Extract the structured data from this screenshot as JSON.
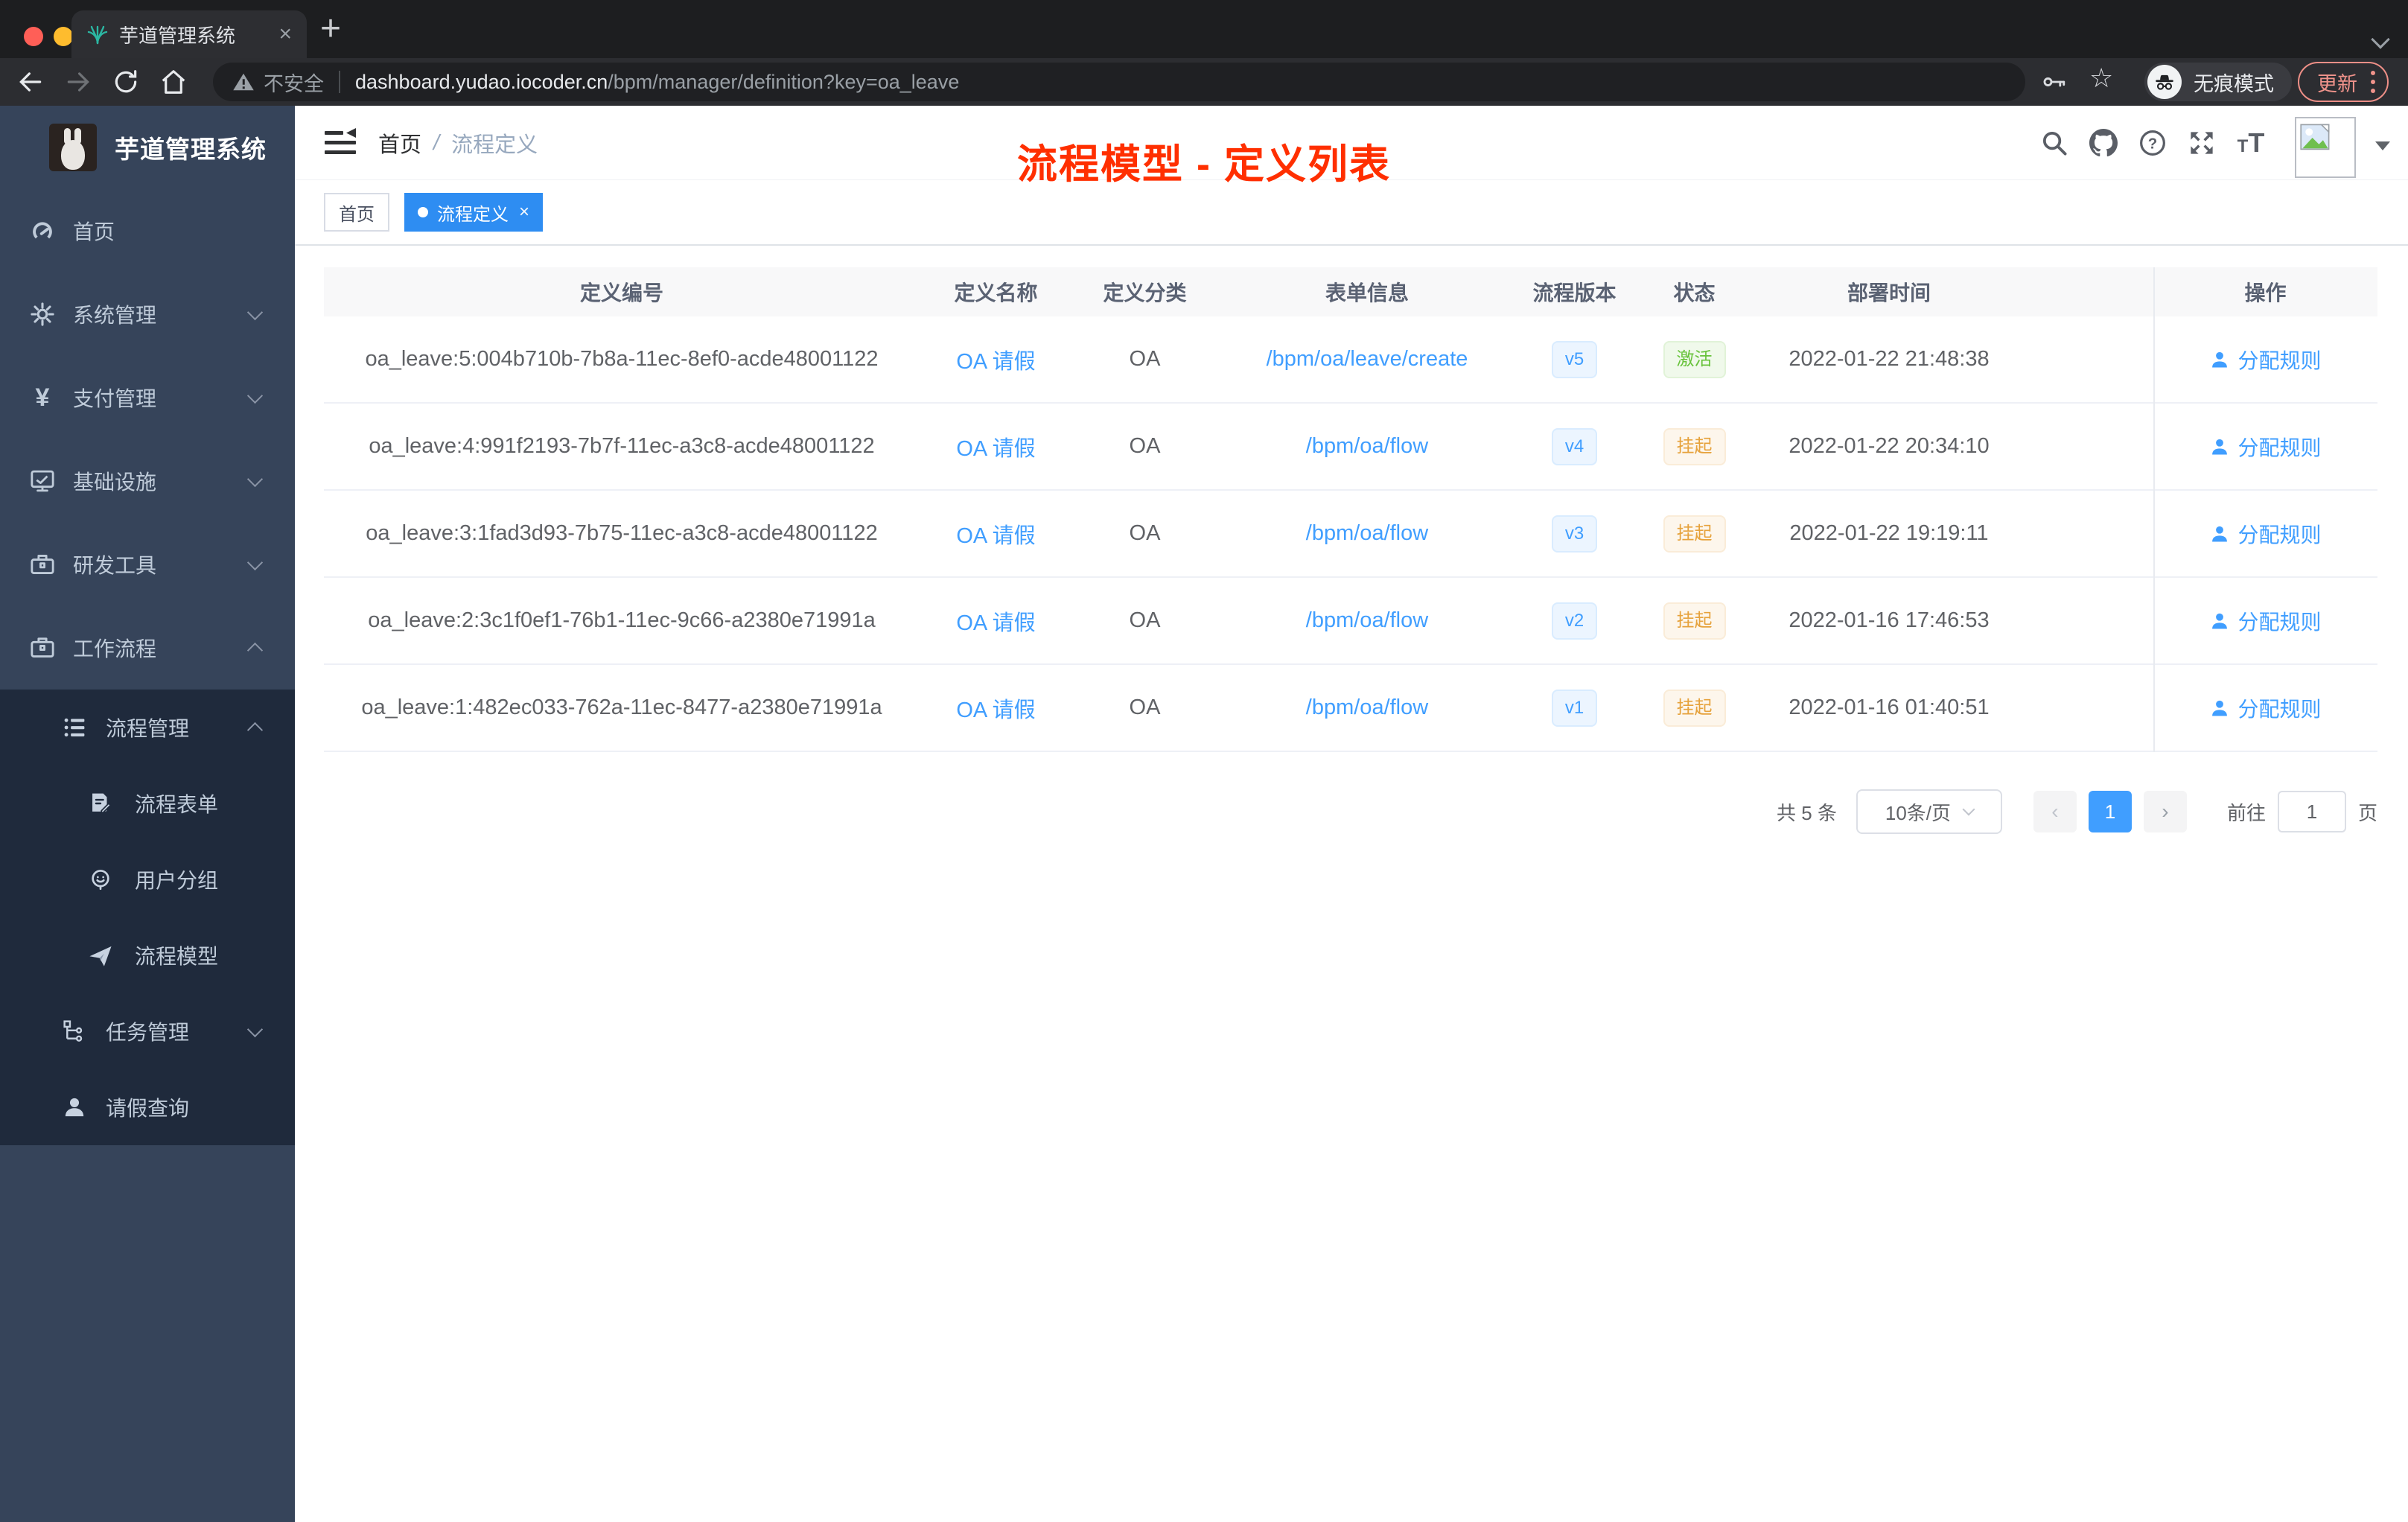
{
  "browser": {
    "tab_title": "芋道管理系统",
    "close_glyph": "×",
    "new_tab_glyph": "+",
    "security_label": "不安全",
    "url_host": "dashboard.yudao.iocoder.cn",
    "url_path": "/bpm/manager/definition?key=oa_leave",
    "incognito_label": "无痕模式",
    "update_label": "更新"
  },
  "sidebar": {
    "logo_title": "芋道管理系统",
    "menu": [
      {
        "label": "首页"
      },
      {
        "label": "系统管理"
      },
      {
        "label": "支付管理"
      },
      {
        "label": "基础设施"
      },
      {
        "label": "研发工具"
      },
      {
        "label": "工作流程"
      },
      {
        "label": "流程管理"
      },
      {
        "label": "流程表单"
      },
      {
        "label": "用户分组"
      },
      {
        "label": "流程模型"
      },
      {
        "label": "任务管理"
      },
      {
        "label": "请假查询"
      }
    ]
  },
  "header": {
    "breadcrumb_home": "首页",
    "breadcrumb_sep": "/",
    "breadcrumb_current": "流程定义",
    "overlay_title": "流程模型 - 定义列表"
  },
  "tags": {
    "home": "首页",
    "current": "流程定义",
    "close_glyph": "×"
  },
  "table": {
    "columns": [
      "定义编号",
      "定义名称",
      "定义分类",
      "表单信息",
      "流程版本",
      "状态",
      "部署时间",
      "操作"
    ],
    "rows": [
      {
        "id": "oa_leave:5:004b710b-7b8a-11ec-8ef0-acde48001122",
        "name": "OA 请假",
        "category": "OA",
        "form": "/bpm/oa/leave/create",
        "version": "v5",
        "status": "激活",
        "status_type": "success",
        "time": "2022-01-22 21:48:38",
        "action": "分配规则"
      },
      {
        "id": "oa_leave:4:991f2193-7b7f-11ec-a3c8-acde48001122",
        "name": "OA 请假",
        "category": "OA",
        "form": "/bpm/oa/flow",
        "version": "v4",
        "status": "挂起",
        "status_type": "warning",
        "time": "2022-01-22 20:34:10",
        "action": "分配规则"
      },
      {
        "id": "oa_leave:3:1fad3d93-7b75-11ec-a3c8-acde48001122",
        "name": "OA 请假",
        "category": "OA",
        "form": "/bpm/oa/flow",
        "version": "v3",
        "status": "挂起",
        "status_type": "warning",
        "time": "2022-01-22 19:19:11",
        "action": "分配规则"
      },
      {
        "id": "oa_leave:2:3c1f0ef1-76b1-11ec-9c66-a2380e71991a",
        "name": "OA 请假",
        "category": "OA",
        "form": "/bpm/oa/flow",
        "version": "v2",
        "status": "挂起",
        "status_type": "warning",
        "time": "2022-01-16 17:46:53",
        "action": "分配规则"
      },
      {
        "id": "oa_leave:1:482ec033-762a-11ec-8477-a2380e71991a",
        "name": "OA 请假",
        "category": "OA",
        "form": "/bpm/oa/flow",
        "version": "v1",
        "status": "挂起",
        "status_type": "warning",
        "time": "2022-01-16 01:40:51",
        "action": "分配规则"
      }
    ]
  },
  "pagination": {
    "total": "共 5 条",
    "page_size": "10条/页",
    "prev_glyph": "‹",
    "next_glyph": "›",
    "current_page": "1",
    "goto_label": "前往",
    "goto_value": "1",
    "page_unit": "页"
  },
  "colors": {
    "accent": "#409eff",
    "success": "#67c23a",
    "warning": "#e6a23c",
    "title_red": "#ff2f00",
    "sidebar_bg": "#36445a",
    "submenu_bg": "#1f2a3c"
  }
}
